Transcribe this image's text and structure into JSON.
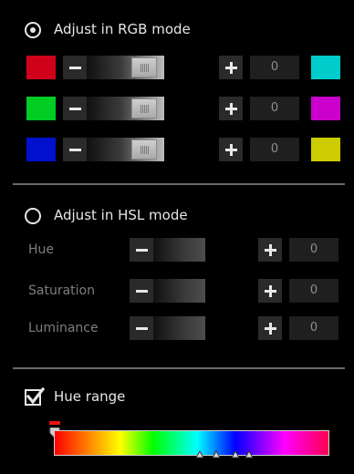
{
  "rgb_mode": {
    "label": "Adjust in RGB mode",
    "selected": true,
    "rows": [
      {
        "channel": "red",
        "swatch_color": "#d0021b",
        "value": "0",
        "complement_color": "#00cccc",
        "slider_level": 0.9
      },
      {
        "channel": "green",
        "swatch_color": "#00cc22",
        "value": "0",
        "complement_color": "#cc00cc",
        "slider_level": 0.9
      },
      {
        "channel": "blue",
        "swatch_color": "#0010cc",
        "value": "0",
        "complement_color": "#cccc00",
        "slider_level": 0.9
      }
    ]
  },
  "hsl_mode": {
    "label": "Adjust in HSL mode",
    "selected": false,
    "rows": [
      {
        "label": "Hue",
        "value": "0"
      },
      {
        "label": "Saturation",
        "value": "0"
      },
      {
        "label": "Luminance",
        "value": "0"
      }
    ]
  },
  "hue_range": {
    "label": "Hue range",
    "checked": true,
    "marker_positions": [
      0.53,
      0.59,
      0.66,
      0.71
    ],
    "start_position": 0.0
  },
  "icons": {
    "minus": "minus-icon",
    "plus": "plus-icon",
    "check": "checkmark-icon",
    "marker": "triangle-up-icon"
  }
}
